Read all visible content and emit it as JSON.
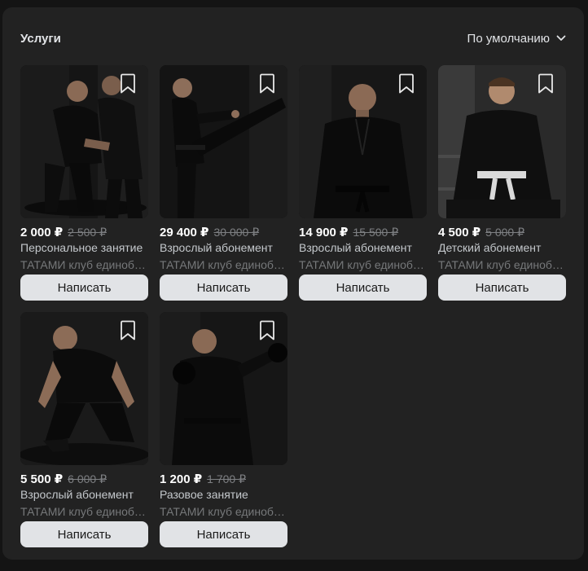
{
  "header": {
    "title": "Услуги",
    "sort_label": "По умолчанию"
  },
  "colors": {
    "panel": "#222222",
    "button_bg": "#e1e3e6",
    "price": "#ffffff",
    "old_price": "#7d7f82"
  },
  "cards": [
    {
      "price": "2 000 ₽",
      "old_price": "2 500 ₽",
      "name": "Персональное занятие",
      "club": "ТАТАМИ клуб единоборств",
      "button": "Написать",
      "image": "two-men-grappling-photo"
    },
    {
      "price": "29 400 ₽",
      "old_price": "30 000 ₽",
      "name": "Взрослый абонемент",
      "club": "ТАТАМИ клуб единоборств",
      "button": "Написать",
      "image": "woman-kick-photo"
    },
    {
      "price": "14 900 ₽",
      "old_price": "15 500 ₽",
      "name": "Взрослый абонемент",
      "club": "ТАТАМИ клуб единоборств",
      "button": "Написать",
      "image": "man-in-gi-photo"
    },
    {
      "price": "4 500 ₽",
      "old_price": "5 000 ₽",
      "name": "Детский абонемент",
      "club": "ТАТАМИ клуб единоборств",
      "button": "Написать",
      "image": "boy-in-gi-photo"
    },
    {
      "price": "5 500 ₽",
      "old_price": "6 000 ₽",
      "name": "Взрослый абонемент",
      "club": "ТАТАМИ клуб единоборств",
      "button": "Написать",
      "image": "wrestler-stance-photo"
    },
    {
      "price": "1 200 ₽",
      "old_price": "1 700 ₽",
      "name": "Разовое занятие",
      "club": "ТАТАМИ клуб единоборств",
      "button": "Написать",
      "image": "boxer-punch-photo"
    }
  ]
}
